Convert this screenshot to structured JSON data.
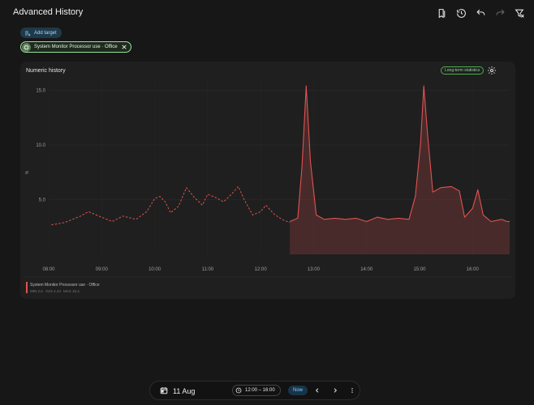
{
  "header": {
    "title": "Advanced History"
  },
  "toolbar": {
    "add_target_label": "Add target"
  },
  "target_chip": {
    "label": "System Monitor Processor use · Office"
  },
  "card": {
    "title": "Numeric history",
    "badge": "Long-term statistics"
  },
  "legend": {
    "name": "System Monitor Processor use · Office",
    "min": "MIN 2.6",
    "avg": "AVG 4.44",
    "max": "MAX 15.4"
  },
  "bottom": {
    "date": "11 Aug",
    "time_range": "12:00 – 16:00",
    "now_label": "Now"
  },
  "colors": {
    "accent": "#e05252",
    "badge_green": "#4caf50"
  },
  "chart_data": {
    "type": "line",
    "ylabel": "%",
    "ylim": [
      0,
      16
    ],
    "yticks": [
      "5.0",
      "10.0",
      "15.0"
    ],
    "ytick_values": [
      5,
      10,
      15
    ],
    "xticks": [
      "08:00",
      "09:00",
      "10:00",
      "11:00",
      "12:00",
      "13:00",
      "14:00",
      "15:00",
      "16:00"
    ],
    "xlim_hours": [
      8,
      16.7
    ],
    "series": [
      {
        "name": "System Monitor Processor use · Office",
        "style_history": "dashed",
        "statistics_points": [
          [
            8.05,
            2.7
          ],
          [
            8.3,
            2.9
          ],
          [
            8.6,
            3.5
          ],
          [
            8.75,
            3.9
          ],
          [
            8.95,
            3.5
          ],
          [
            9.2,
            3.0
          ],
          [
            9.4,
            3.5
          ],
          [
            9.65,
            3.2
          ],
          [
            9.85,
            3.9
          ],
          [
            10.0,
            5.1
          ],
          [
            10.1,
            5.3
          ],
          [
            10.2,
            4.8
          ],
          [
            10.3,
            3.8
          ],
          [
            10.45,
            4.4
          ],
          [
            10.6,
            6.1
          ],
          [
            10.75,
            5.2
          ],
          [
            10.9,
            4.5
          ],
          [
            11.0,
            5.5
          ],
          [
            11.15,
            5.2
          ],
          [
            11.3,
            4.8
          ],
          [
            11.45,
            5.5
          ],
          [
            11.58,
            6.2
          ],
          [
            11.7,
            4.9
          ],
          [
            11.85,
            3.6
          ],
          [
            12.0,
            3.9
          ],
          [
            12.1,
            4.5
          ],
          [
            12.25,
            3.7
          ],
          [
            12.4,
            3.2
          ],
          [
            12.55,
            2.9
          ]
        ],
        "history_points": [
          [
            12.55,
            3.0
          ],
          [
            12.7,
            3.3
          ],
          [
            12.78,
            8.0
          ],
          [
            12.86,
            15.4
          ],
          [
            12.94,
            8.5
          ],
          [
            13.05,
            3.6
          ],
          [
            13.2,
            3.2
          ],
          [
            13.4,
            3.3
          ],
          [
            13.6,
            3.2
          ],
          [
            13.8,
            3.3
          ],
          [
            14.0,
            3.0
          ],
          [
            14.2,
            3.4
          ],
          [
            14.4,
            3.2
          ],
          [
            14.6,
            3.3
          ],
          [
            14.8,
            3.2
          ],
          [
            14.92,
            5.3
          ],
          [
            15.02,
            10.2
          ],
          [
            15.08,
            15.4
          ],
          [
            15.15,
            11.0
          ],
          [
            15.25,
            5.7
          ],
          [
            15.4,
            6.1
          ],
          [
            15.6,
            6.2
          ],
          [
            15.75,
            5.8
          ],
          [
            15.85,
            3.4
          ],
          [
            16.0,
            4.2
          ],
          [
            16.1,
            5.9
          ],
          [
            16.2,
            3.6
          ],
          [
            16.35,
            3.0
          ],
          [
            16.55,
            3.2
          ],
          [
            16.65,
            3.0
          ],
          [
            16.7,
            3.0
          ]
        ]
      }
    ],
    "grid": true,
    "legend_position": "bottom-left"
  }
}
